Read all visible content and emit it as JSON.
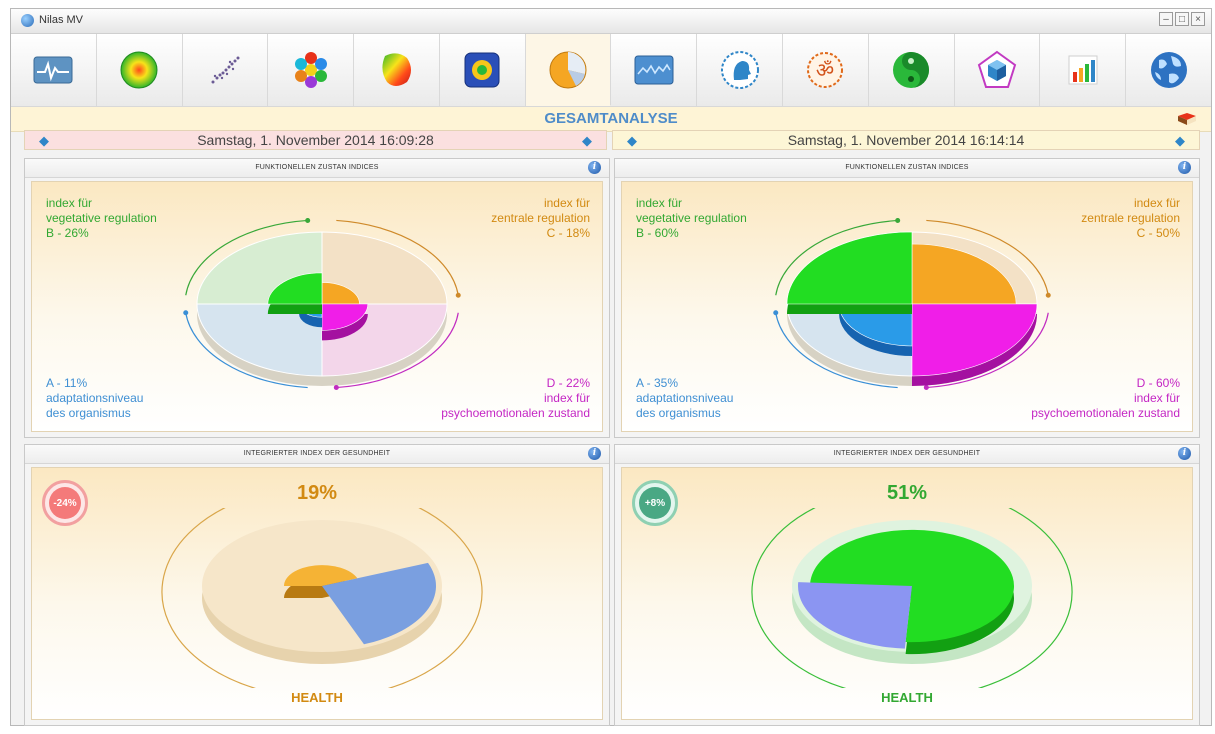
{
  "window": {
    "title": "Nilas MV"
  },
  "toolbar": {
    "items": [
      {
        "icon": "monitor-waveform-icon"
      },
      {
        "icon": "radial-gradient-icon"
      },
      {
        "icon": "scatter-dots-icon"
      },
      {
        "icon": "molecule-icon"
      },
      {
        "icon": "heatmap-icon"
      },
      {
        "icon": "frequency-map-icon"
      },
      {
        "icon": "pie-chart-icon",
        "active": true
      },
      {
        "icon": "wave-graph-icon"
      },
      {
        "icon": "head-profile-icon"
      },
      {
        "icon": "om-icon"
      },
      {
        "icon": "yin-yang-icon"
      },
      {
        "icon": "pentagon-cube-icon"
      },
      {
        "icon": "bar-chart-icon"
      },
      {
        "icon": "globe-icon"
      }
    ]
  },
  "section": {
    "title": "GESAMTANALYSE"
  },
  "left": {
    "date": "Samstag, 1. November 2014 16:09:28",
    "functional": {
      "title": "FUNKTIONELLEN ZUSTAN INDICES",
      "b_label1": "index für",
      "b_label2": "vegetative regulation",
      "b_value": "B - 26%",
      "c_label1": "index für",
      "c_label2": "zentrale regulation",
      "c_value": "C - 18%",
      "a_value": "A - 11%",
      "a_label1": "adaptationsniveau",
      "a_label2": "des organismus",
      "d_value": "D - 22%",
      "d_label1": "index für",
      "d_label2": "psychoemotionalen zustand"
    },
    "health": {
      "title": "INTEGRIERTER INDEX DER GESUNDHEIT",
      "percent": "19%",
      "change": "-24%",
      "label": "HEALTH"
    }
  },
  "right": {
    "date": "Samstag, 1. November 2014 16:14:14",
    "functional": {
      "title": "FUNKTIONELLEN ZUSTAN INDICES",
      "b_label1": "index für",
      "b_label2": "vegetative regulation",
      "b_value": "B - 60%",
      "c_label1": "index für",
      "c_label2": "zentrale regulation",
      "c_value": "C - 50%",
      "a_value": "A - 35%",
      "a_label1": "adaptationsniveau",
      "a_label2": "des organismus",
      "d_value": "D - 60%",
      "d_label1": "index für",
      "d_label2": "psychoemotionalen zustand"
    },
    "health": {
      "title": "INTEGRIERTER INDEX DER GESUNDHEIT",
      "percent": "51%",
      "change": "+8%",
      "label": "HEALTH"
    }
  },
  "chart_data": [
    {
      "type": "pie",
      "categories": [
        "A",
        "B",
        "C",
        "D"
      ],
      "values": [
        11,
        26,
        18,
        22
      ]
    },
    {
      "type": "pie",
      "categories": [
        "A",
        "B",
        "C",
        "D"
      ],
      "values": [
        35,
        60,
        50,
        60
      ]
    },
    {
      "type": "pie",
      "categories": [
        "HEALTH"
      ],
      "values": [
        19
      ]
    },
    {
      "type": "pie",
      "categories": [
        "HEALTH"
      ],
      "values": [
        51
      ]
    }
  ]
}
